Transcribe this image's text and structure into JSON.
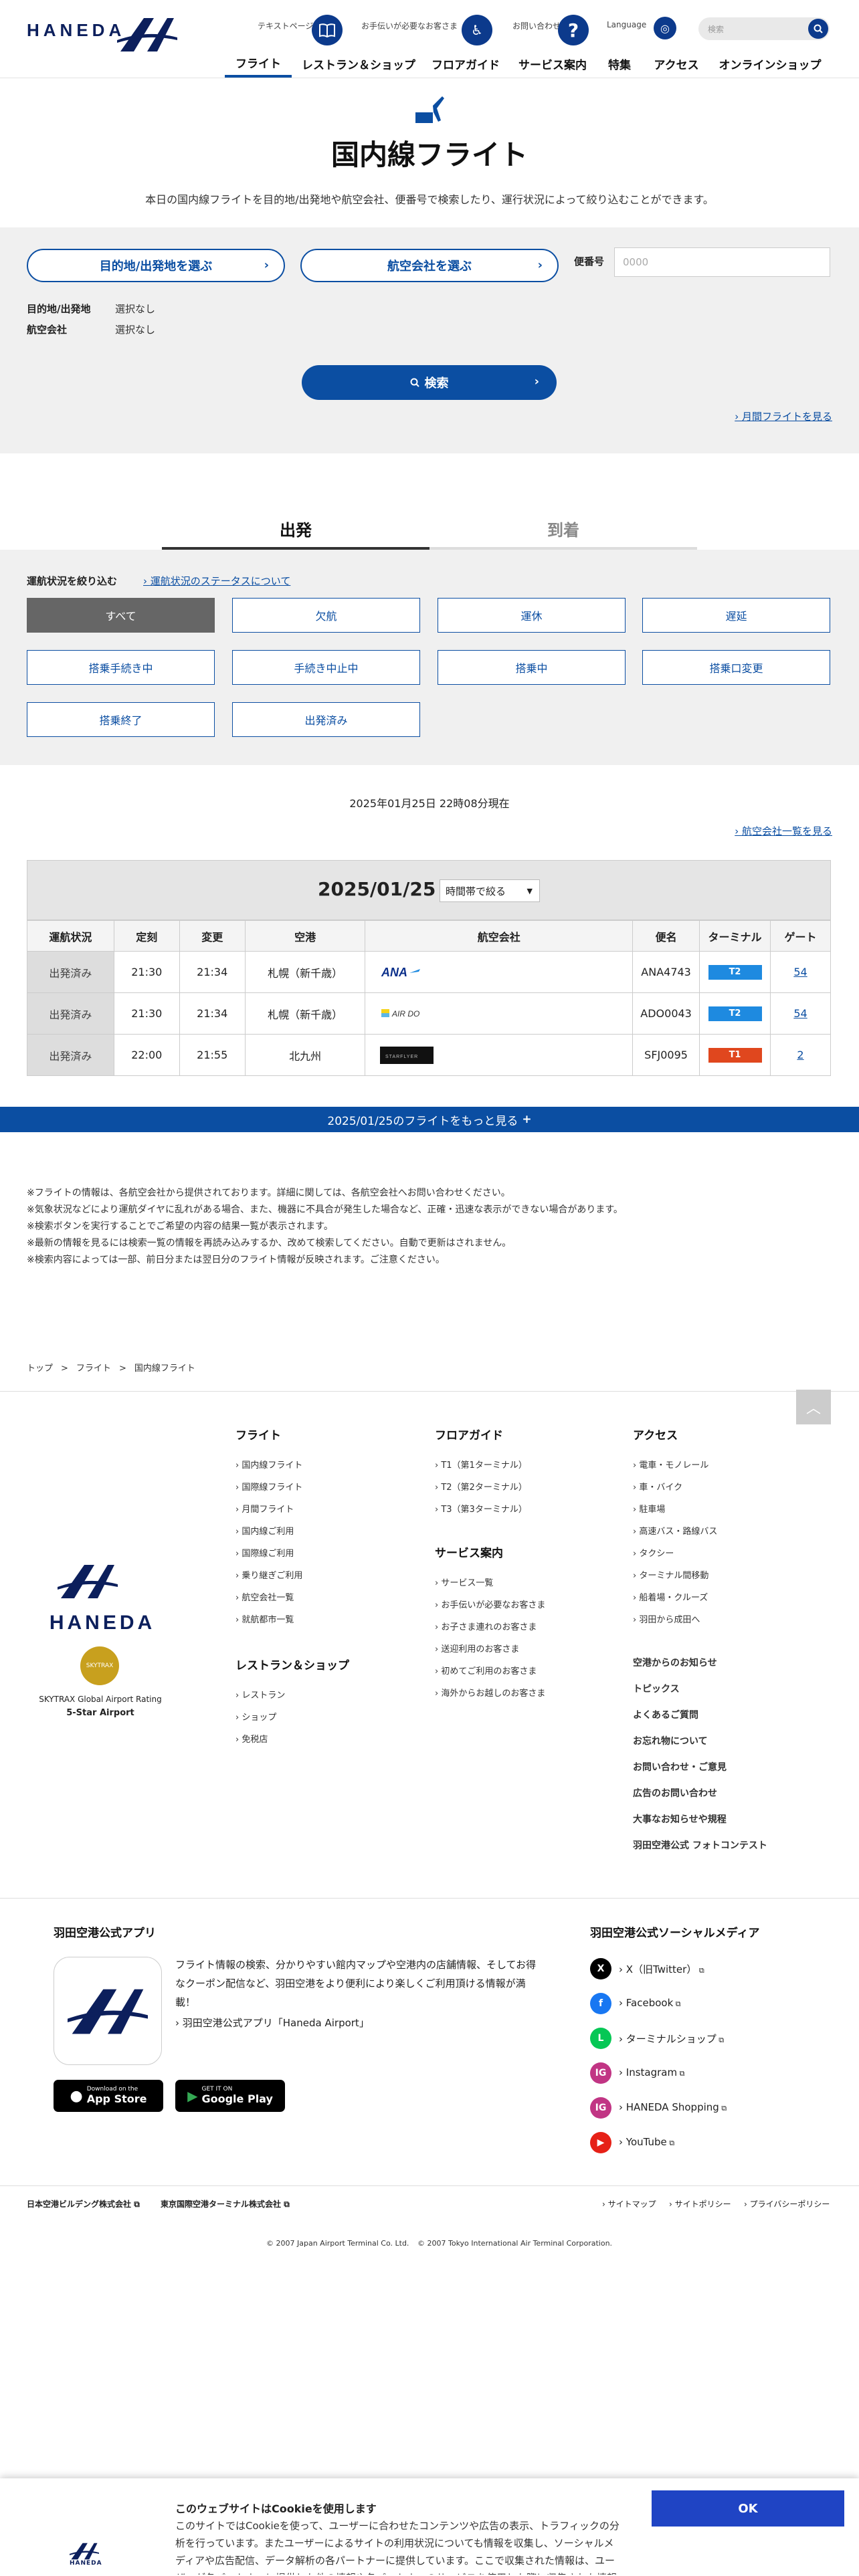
{
  "header": {
    "logo": "HANEDA",
    "util": {
      "text": "テキストページ",
      "assist": "お手伝いが必要なお客さま",
      "contact": "お問い合わせ",
      "language": "Language",
      "search_placeholder": "検索"
    },
    "nav": [
      "フライト",
      "レストラン＆ショップ",
      "フロアガイド",
      "サービス案内",
      "特集",
      "アクセス",
      "オンラインショップ"
    ]
  },
  "page": {
    "title": "国内線フライト",
    "description": "本日の国内線フライトを目的地/出発地や航空会社、便番号で検索したり、運行状況によって絞り込むことができます。"
  },
  "search": {
    "dest_button": "目的地/出発地を選ぶ",
    "airline_button": "航空会社を選ぶ",
    "flight_no_label": "便番号",
    "flight_no_placeholder": "0000",
    "cond_dest_label": "目的地/出発地",
    "cond_dest_value": "選択なし",
    "cond_airline_label": "航空会社",
    "cond_airline_value": "選択なし",
    "search_button": "検索",
    "monthly_link": "月間フライトを見る"
  },
  "tabs": {
    "departure": "出発",
    "arrival": "到着"
  },
  "status_filter": {
    "title": "運航状況を絞り込む",
    "about_link": "運航状況のステータスについて",
    "buttons": [
      "すべて",
      "欠航",
      "運休",
      "遅延",
      "搭乗手続き中",
      "手続き中止中",
      "搭乗中",
      "搭乗口変更",
      "搭乗終了",
      "出発済み"
    ]
  },
  "results": {
    "current_time": "2025年01月25日 22時08分現在",
    "airline_list_link": "航空会社一覧を見る",
    "date": "2025/01/25",
    "time_filter": "時間帯で絞る",
    "columns": [
      "運航状況",
      "定刻",
      "変更",
      "空港",
      "航空会社",
      "便名",
      "ターミナル",
      "ゲート"
    ],
    "rows": [
      {
        "status": "出発済み",
        "scheduled": "21:30",
        "changed": "21:34",
        "airport": "札幌（新千歳）",
        "airline_logo": "ANA",
        "flight": "ANA4743",
        "terminal": "T2",
        "terminal_color": "#1e8ae0",
        "gate": "54"
      },
      {
        "status": "出発済み",
        "scheduled": "21:30",
        "changed": "21:34",
        "airport": "札幌（新千歳）",
        "airline_logo": "AIR DO",
        "flight": "ADO0043",
        "terminal": "T2",
        "terminal_color": "#1e8ae0",
        "gate": "54"
      },
      {
        "status": "出発済み",
        "scheduled": "22:00",
        "changed": "21:55",
        "airport": "北九州",
        "airline_logo": "STARFLYER",
        "flight": "SFJ0095",
        "terminal": "T1",
        "terminal_color": "#e0471e",
        "gate": "2"
      }
    ],
    "more": "2025/01/25のフライトをもっと見る"
  },
  "notes": [
    "※フライトの情報は、各航空会社から提供されております。詳細に関しては、各航空会社へお問い合わせください。",
    "※気象状況などにより運航ダイヤに乱れがある場合、また、機器に不具合が発生した場合など、正確・迅速な表示ができない場合があります。",
    "※検索ボタンを実行することでご希望の内容の結果一覧が表示されます。",
    "※最新の情報を見るには検索一覧の情報を再読み込みするか、改めて検索してください。自動で更新はされません。",
    "※検索内容によっては一部、前日分または翌日分のフライト情報が反映されます。ご注意ください。"
  ],
  "breadcrumb": [
    "トップ",
    "フライト",
    "国内線フライト"
  ],
  "footer": {
    "logo": "HANEDA",
    "award_badge": "SKYTRAX",
    "award_line1": "SKYTRAX Global Airport Rating",
    "award_line2": "5-Star Airport",
    "flight": {
      "head": "フライト",
      "links": [
        "国内線フライト",
        "国際線フライト",
        "月間フライト",
        "国内線ご利用",
        "国際線ご利用",
        "乗り継ぎご利用",
        "航空会社一覧",
        "就航都市一覧"
      ]
    },
    "restaurant": {
      "head": "レストラン＆ショップ",
      "links": [
        "レストラン",
        "ショップ",
        "免税店"
      ]
    },
    "floor": {
      "head": "フロアガイド",
      "links": [
        "T1（第1ターミナル）",
        "T2（第2ターミナル）",
        "T3（第3ターミナル）"
      ]
    },
    "service": {
      "head": "サービス案内",
      "links": [
        "サービス一覧",
        "お手伝いが必要なお客さま",
        "お子さま連れのお客さま",
        "送迎利用のお客さま",
        "初めてご利用のお客さま",
        "海外からお越しのお客さま"
      ]
    },
    "access": {
      "head": "アクセス",
      "links": [
        "電車・モノレール",
        "車・バイク",
        "駐車場",
        "高速バス・路線バス",
        "タクシー",
        "ターミナル間移動",
        "船着場・クルーズ",
        "羽田から成田へ"
      ]
    },
    "misc": [
      "空港からのお知らせ",
      "トピックス",
      "よくあるご質問",
      "お忘れ物について",
      "お問い合わせ・ご意見",
      "広告のお問い合わせ",
      "大事なお知らせや規程",
      "羽田空港公式 フォトコンテスト"
    ]
  },
  "app": {
    "head": "羽田空港公式アプリ",
    "description": "フライト情報の検索、分かりやすい館内マップや空港内の店舗情報、そしてお得なクーポン配信など、羽田空港をより便利により楽しくご利用頂ける情報が満載！",
    "link": "羽田空港公式アプリ「Haneda Airport」",
    "app_store_top": "Download on the",
    "app_store": "App Store",
    "google_play_top": "GET IT ON",
    "google_play": "Google Play"
  },
  "social": {
    "head": "羽田空港公式ソーシャルメディア",
    "links": [
      "X（旧Twitter）",
      "Facebook",
      "ターミナルショップ",
      "Instagram",
      "HANEDA Shopping",
      "YouTube"
    ],
    "icons": [
      "X",
      "f",
      "L",
      "IG",
      "IG",
      "▶"
    ],
    "colors": [
      "#000000",
      "#1877f2",
      "#06c755",
      "#c13584",
      "#c13584",
      "#e62117"
    ]
  },
  "bottom": {
    "left_links": [
      "日本空港ビルデング株式会社",
      "東京国際空港ターミナル株式会社"
    ],
    "right_links": [
      "サイトマップ",
      "サイトポリシー",
      "プライバシーポリシー"
    ],
    "copyright1": "© 2007 Japan Airport Terminal Co. Ltd.",
    "copyright2": "© 2007 Tokyo International Air Terminal Corporation."
  },
  "cookie": {
    "title": "このウェブサイトはCookieを使用します",
    "text": "このサイトではCookieを使って、ユーザーに合わせたコンテンツや広告の表示、トラフィックの分析を行っています。またユーザーによるサイトの利用状況についても情報を収集し、ソーシャルメディアや広告配信、データ解析の各パートナーに提供しています。ここで収集された情報は、ユーザーが各パートナーに提供した他の情報や各パートナーのサービスを使用した際に収集された情報と組み合わせられることがあります。",
    "ok": "OK",
    "logo": "HANEDA"
  }
}
